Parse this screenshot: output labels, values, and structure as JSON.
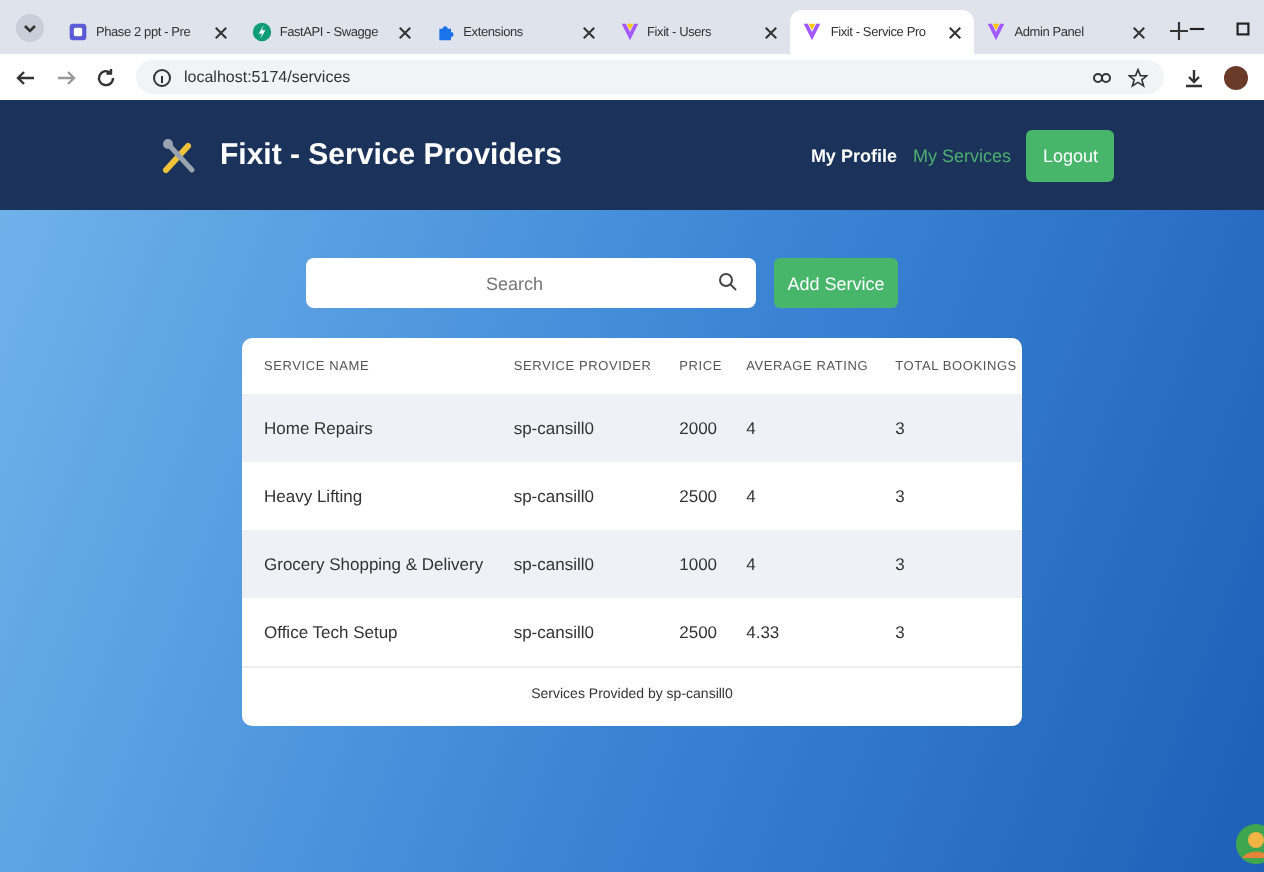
{
  "browser": {
    "tabs": [
      {
        "title": "Phase 2 ppt - Pre",
        "kind": "doc",
        "selected": false
      },
      {
        "title": "FastAPI - Swagge",
        "kind": "api",
        "selected": false
      },
      {
        "title": "Extensions",
        "kind": "puzzle",
        "selected": false
      },
      {
        "title": "Fixit - Users",
        "kind": "v",
        "selected": false
      },
      {
        "title": "Fixit - Service Pro",
        "kind": "v",
        "selected": true
      },
      {
        "title": "Admin Panel",
        "kind": "v",
        "selected": false
      }
    ],
    "address": "localhost:5174/services"
  },
  "navbar": {
    "brand": "Fixit - Service Providers",
    "links": [
      {
        "label": "My Profile",
        "selected": false
      },
      {
        "label": "My Services",
        "selected": true
      }
    ],
    "logout": "Logout"
  },
  "search": {
    "placeholder": "Search"
  },
  "add_button": "Add Service",
  "table": {
    "columns": [
      "SERVICE NAME",
      "SERVICE PROVIDER",
      "PRICE",
      "AVERAGE RATING",
      "TOTAL BOOKINGS"
    ],
    "rows": [
      [
        "Home Repairs",
        "sp-cansill0",
        "2000",
        "4",
        "3"
      ],
      [
        "Heavy Lifting",
        "sp-cansill0",
        "2500",
        "4",
        "3"
      ],
      [
        "Grocery Shopping & Delivery",
        "sp-cansill0",
        "1000",
        "4",
        "3"
      ],
      [
        "Office Tech Setup",
        "sp-cansill0",
        "2500",
        "4.33",
        "3"
      ]
    ],
    "footer": "Services Provided by sp-cansill0"
  }
}
